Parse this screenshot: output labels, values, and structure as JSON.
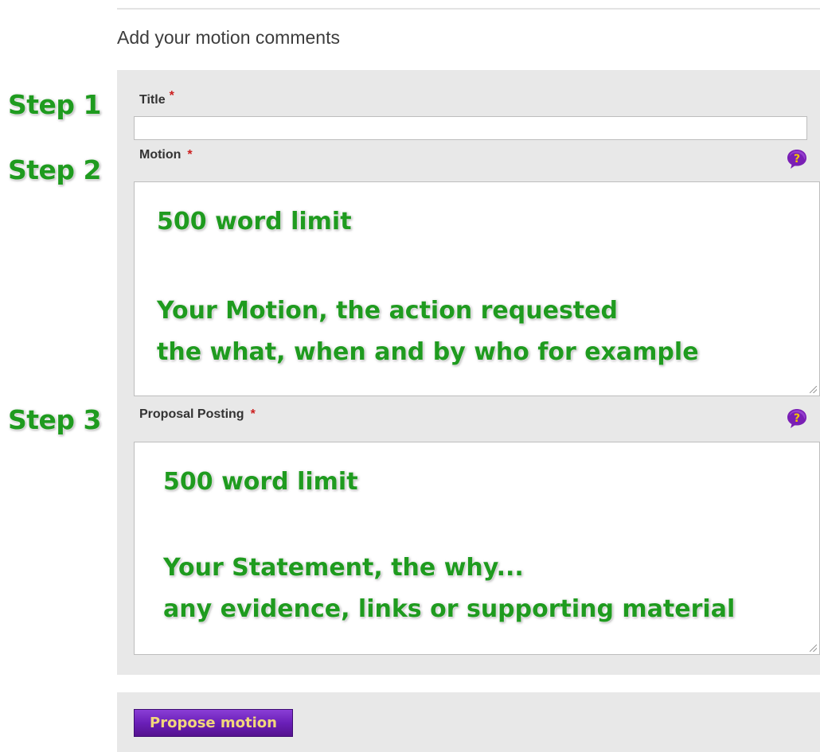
{
  "form": {
    "heading": "Add your motion comments",
    "required_marker": "*"
  },
  "steps": {
    "step1": "Step 1",
    "step2": "Step 2",
    "step3": "Step 3"
  },
  "fields": {
    "title": {
      "label": "Title",
      "value": ""
    },
    "motion": {
      "label": "Motion",
      "help_icon": "question-bubble-icon",
      "lines": [
        "500 word limit",
        "Your Motion, the action requested",
        "the what, when and by who for example"
      ]
    },
    "proposal_posting": {
      "label": "Proposal Posting",
      "help_icon": "question-bubble-icon",
      "lines": [
        "500 word limit",
        "Your Statement, the why...",
        "any evidence, links or supporting material"
      ]
    }
  },
  "actions": {
    "submit_label": "Propose motion"
  },
  "colors": {
    "step_text": "#1f9b1f",
    "required": "#cc1f1f",
    "button_bg": "#6a1fb8",
    "button_text": "#f2d77a",
    "panel_bg": "#e8e8e8",
    "help_icon_bg": "#7a1fb5",
    "help_icon_mark": "#f5c400"
  }
}
